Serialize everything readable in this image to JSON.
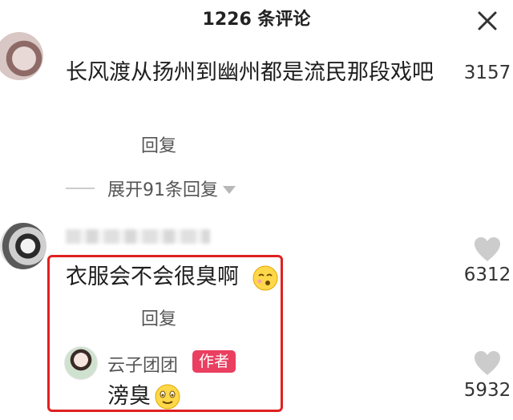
{
  "header": {
    "title": "1226 条评论",
    "close_icon": "close-icon"
  },
  "comments": [
    {
      "text": "长风渡从扬州到幽州都是流民那段戏吧",
      "reply_label": "回复",
      "expand_label": "展开91条回复",
      "likes": "3157"
    },
    {
      "text": "衣服会不会很臭啊",
      "emoji": "wink-kiss-emoji",
      "reply_label": "回复",
      "likes": "6312",
      "reply": {
        "author": "云子团团",
        "badge": "作者",
        "text": "滂臭",
        "emoji": "smile-emoji",
        "likes": "5932"
      }
    }
  ],
  "colors": {
    "badge_bg": "#ea3f60",
    "highlight_border": "#e02020",
    "heart": "#cccccc"
  }
}
